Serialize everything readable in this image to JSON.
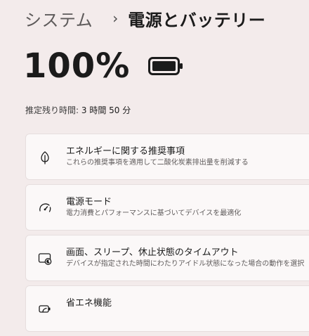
{
  "breadcrumb": {
    "parent": "システム",
    "separator": "›",
    "current": "電源とバッテリー"
  },
  "battery": {
    "percent": "100%",
    "level": 1.0,
    "icon": "battery-full-icon"
  },
  "remaining": {
    "label": "推定残り時間:",
    "value": "3 時間 50 分"
  },
  "cards": [
    {
      "title": "エネルギーに関する推奨事項",
      "description": "これらの推奨事項を適用して二酸化炭素排出量を削減する",
      "icon": "leaf-icon"
    },
    {
      "title": "電源モード",
      "description": "電力消費とパフォーマンスに基づいてデバイスを最適化",
      "icon": "power-mode-icon"
    },
    {
      "title": "画面、スリープ、休止状態のタイムアウト",
      "description": "デバイスが指定された時間にわたりアイドル状態になった場合の動作を選択",
      "icon": "screen-sleep-icon"
    },
    {
      "title": "省エネ機能",
      "description": "",
      "icon": "energy-saver-icon"
    }
  ]
}
